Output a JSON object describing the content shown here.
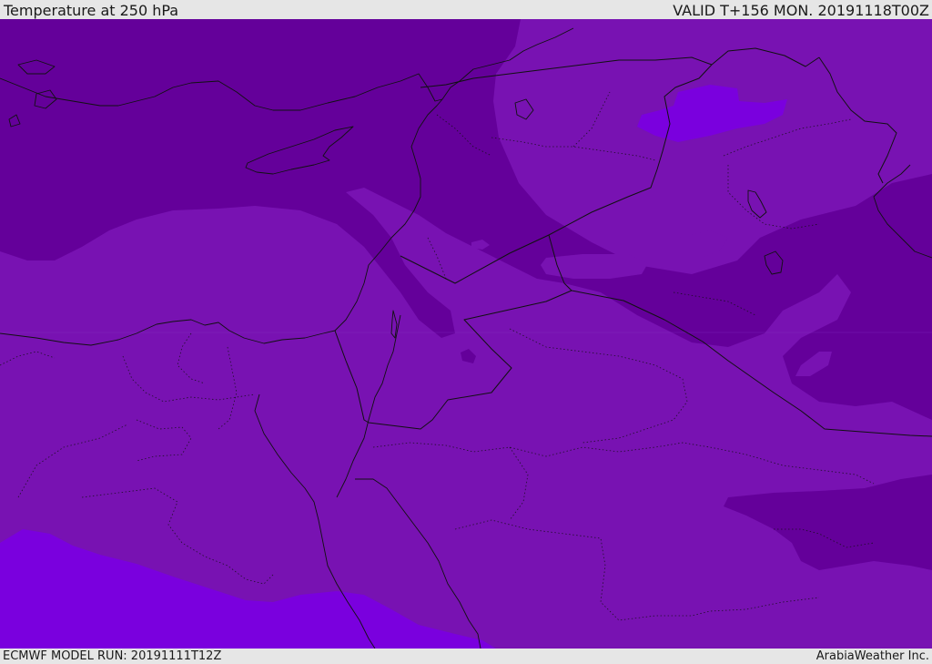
{
  "header": {
    "title": "Temperature at 250 hPa",
    "valid_time": "VALID T+156 MON. 20191118T00Z"
  },
  "footer": {
    "model_run": "ECMWF MODEL RUN: 20191111T12Z",
    "credit": "ArabiaWeather Inc."
  },
  "map": {
    "colors": {
      "dark_band": "#64009a",
      "mid_band": "#7812b2",
      "light_band": "#7a00de",
      "outline": "#111111"
    }
  }
}
